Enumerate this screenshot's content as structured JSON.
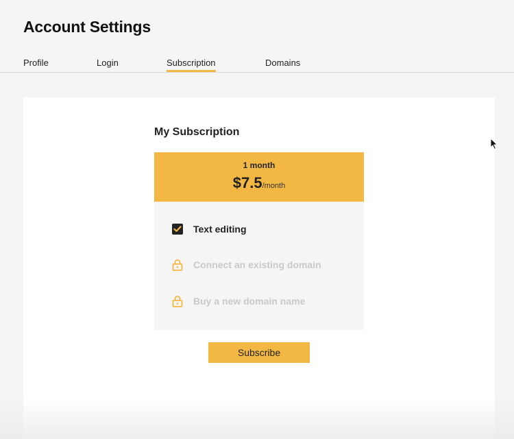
{
  "page": {
    "title": "Account Settings"
  },
  "tabs": [
    {
      "label": "Profile",
      "active": false
    },
    {
      "label": "Login",
      "active": false
    },
    {
      "label": "Subscription",
      "active": true
    },
    {
      "label": "Domains",
      "active": false
    }
  ],
  "subscription": {
    "section_title": "My Subscription",
    "plan": {
      "name": "1 month",
      "price": "$7.5",
      "period": "/month"
    },
    "features": [
      {
        "label": "Text editing",
        "status": "included",
        "icon": "checkbox-checked-icon"
      },
      {
        "label": "Connect an existing domain",
        "status": "locked",
        "icon": "lock-icon"
      },
      {
        "label": "Buy a new domain name",
        "status": "locked",
        "icon": "lock-icon"
      }
    ],
    "subscribe_label": "Subscribe"
  },
  "colors": {
    "accent": "#f3b843",
    "background": "#f5f5f5",
    "panel": "#ffffff",
    "text": "#222222",
    "locked_text": "#c9c9c9"
  }
}
